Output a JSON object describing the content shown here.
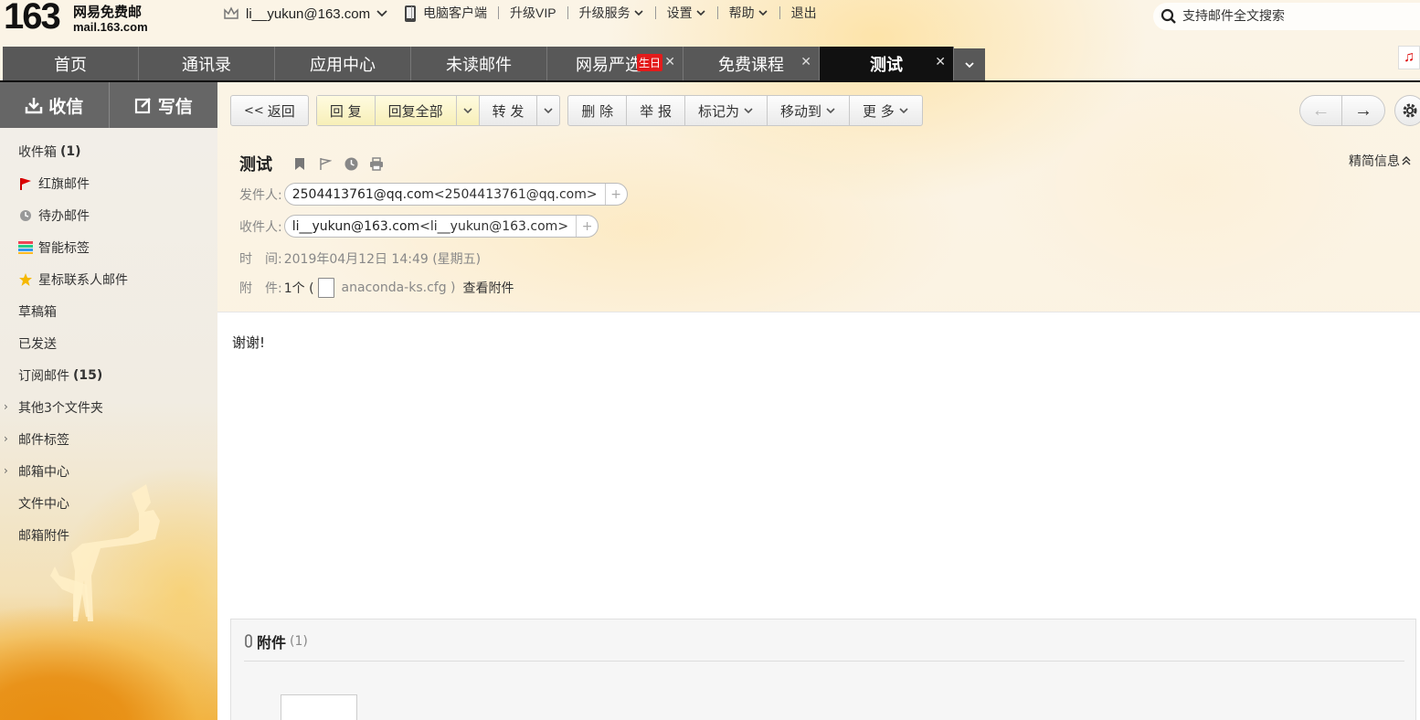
{
  "logo": {
    "number": "163",
    "brand": "网易免费邮",
    "domain": "mail.163.com"
  },
  "user": {
    "email": "li__yukun@163.com"
  },
  "topnav": [
    "电脑客户端",
    "升级VIP",
    "升级服务",
    "设置",
    "帮助",
    "退出"
  ],
  "search": {
    "placeholder": "支持邮件全文搜索"
  },
  "tabs": [
    {
      "label": "首页"
    },
    {
      "label": "通讯录"
    },
    {
      "label": "应用中心"
    },
    {
      "label": "未读邮件"
    },
    {
      "label": "网易严选",
      "badge": "生日"
    },
    {
      "label": "免费课程"
    },
    {
      "label": "测试"
    }
  ],
  "sidebar": {
    "receive": "收信",
    "compose": "写信",
    "folders": [
      {
        "label": "收件箱",
        "count": "(1)"
      },
      {
        "label": "红旗邮件",
        "icon": "flag-icon"
      },
      {
        "label": "待办邮件",
        "icon": "clock-icon"
      },
      {
        "label": "智能标签",
        "icon": "tag-stack-icon"
      },
      {
        "label": "星标联系人邮件",
        "icon": "star-icon"
      },
      {
        "label": "草稿箱"
      },
      {
        "label": "已发送"
      },
      {
        "label": "订阅邮件",
        "count": "(15)"
      },
      {
        "label": "其他3个文件夹",
        "expandable": true
      },
      {
        "label": "邮件标签",
        "expandable": true
      },
      {
        "label": "邮箱中心",
        "expandable": true
      },
      {
        "label": "文件中心"
      },
      {
        "label": "邮箱附件"
      }
    ]
  },
  "toolbar": {
    "back": "返回",
    "reply": "回 复",
    "reply_all": "回复全部",
    "forward": "转 发",
    "delete": "删 除",
    "report": "举 报",
    "mark_as": "标记为",
    "move_to": "移动到",
    "more": "更 多"
  },
  "mail": {
    "subject": "测试",
    "brief_info": "精简信息",
    "from_label": "发件人:",
    "from_value": "2504413761@qq.com",
    "from_addr": "<2504413761@qq.com>",
    "to_label": "收件人:",
    "to_value": "li__yukun@163.com",
    "to_addr": "<li__yukun@163.com>",
    "time_label": "时　间:",
    "time_value": "2019年04月12日 14:49 (星期五)",
    "attach_label": "附　件:",
    "attach_count": "1个 (",
    "attach_name": "anaconda-ks.cfg )",
    "view_attach": "查看附件",
    "body": "谢谢!",
    "attach_section_title": "附件",
    "attach_section_count": "(1)"
  }
}
